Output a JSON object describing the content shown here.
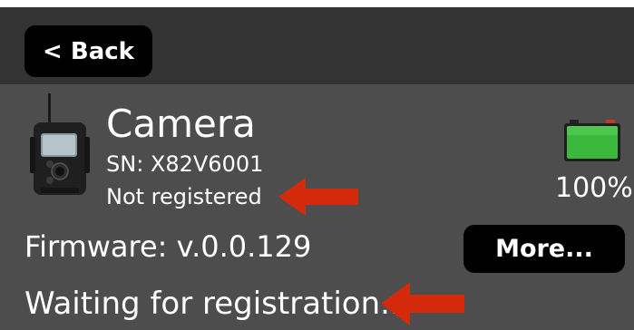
{
  "header": {
    "back_label": "< Back"
  },
  "device": {
    "name": "Camera",
    "serial": "SN: X82V6001",
    "registration_status": "Not registered",
    "icon": "trail-camera-icon"
  },
  "battery": {
    "icon": "battery-icon",
    "level_percent": 100,
    "label": "100%",
    "fill_color": "#3cb83c"
  },
  "firmware": {
    "label": "Firmware: v.0.0.129"
  },
  "actions": {
    "more_label": "More..."
  },
  "status": {
    "waiting_text": "Waiting for registration.."
  },
  "annotations": {
    "arrow_color": "#d42a0c",
    "arrow_icon": "red-left-arrow-icon"
  },
  "colors": {
    "header_background": "#333333",
    "panel_background": "#4d4d4d",
    "button_background": "#000000",
    "text": "#ffffff"
  }
}
